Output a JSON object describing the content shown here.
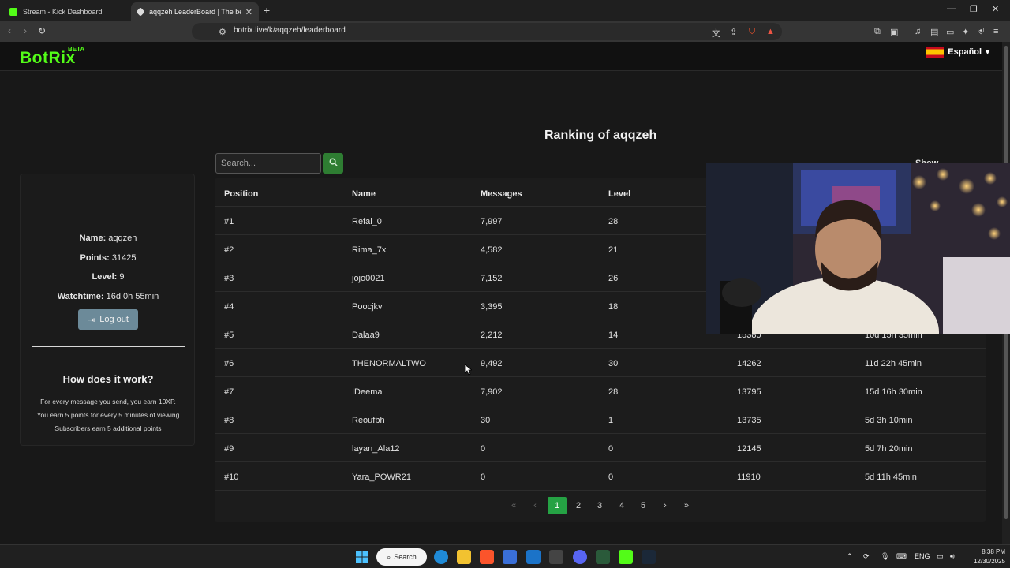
{
  "browser": {
    "tabs": [
      {
        "title": "Stream - Kick Dashboard"
      },
      {
        "title": "aqqzeh LeaderBoard | The best C"
      }
    ],
    "url": "botrix.live/k/aqqzeh/leaderboard"
  },
  "site": {
    "logo": "BotRix",
    "beta": "BETA",
    "language": "Español"
  },
  "heading": "Ranking of aqqzeh",
  "search": {
    "placeholder": "Search..."
  },
  "show_label": "Show",
  "profile": {
    "name_label": "Name:",
    "name": "aqqzeh",
    "points_label": "Points:",
    "points": "31425",
    "level_label": "Level:",
    "level": "9",
    "watchtime_label": "Watchtime:",
    "watchtime": "16d 0h 55min",
    "logout": "Log out"
  },
  "how": {
    "title": "How does it work?",
    "rules": [
      "For every message you send, you earn 10XP.",
      "You earn 5 points for every 5 minutes of viewing",
      "Subscribers earn 5 additional points"
    ]
  },
  "table": {
    "columns": [
      "Position",
      "Name",
      "Messages",
      "Level"
    ],
    "rows": [
      {
        "pos": "#1",
        "name": "Refal_0",
        "messages": "7,997",
        "level": "28",
        "points": "",
        "watch": ""
      },
      {
        "pos": "#2",
        "name": "Rima_7x",
        "messages": "4,582",
        "level": "21",
        "points": "",
        "watch": ""
      },
      {
        "pos": "#3",
        "name": "jojo0021",
        "messages": "7,152",
        "level": "26",
        "points": "",
        "watch": ""
      },
      {
        "pos": "#4",
        "name": "Poocjkv",
        "messages": "3,395",
        "level": "18",
        "points": "",
        "watch": ""
      },
      {
        "pos": "#5",
        "name": "Dalaa9",
        "messages": "2,212",
        "level": "14",
        "points": "15380",
        "watch": "10d 15h 35min"
      },
      {
        "pos": "#6",
        "name": "THENORMALTWO",
        "messages": "9,492",
        "level": "30",
        "points": "14262",
        "watch": "11d 22h 45min"
      },
      {
        "pos": "#7",
        "name": "IDeema",
        "messages": "7,902",
        "level": "28",
        "points": "13795",
        "watch": "15d 16h 30min"
      },
      {
        "pos": "#8",
        "name": "Reoufbh",
        "messages": "30",
        "level": "1",
        "points": "13735",
        "watch": "5d 3h 10min"
      },
      {
        "pos": "#9",
        "name": "layan_Ala12",
        "messages": "0",
        "level": "0",
        "points": "12145",
        "watch": "5d 7h 20min"
      },
      {
        "pos": "#10",
        "name": "Yara_POWR21",
        "messages": "0",
        "level": "0",
        "points": "11910",
        "watch": "5d 11h 45min"
      }
    ]
  },
  "pagination": {
    "pages": [
      "1",
      "2",
      "3",
      "4",
      "5"
    ],
    "current": "1"
  },
  "taskbar": {
    "search": "Search",
    "lang": "ENG",
    "time": "8:38 PM",
    "date": "12/30/2025"
  }
}
